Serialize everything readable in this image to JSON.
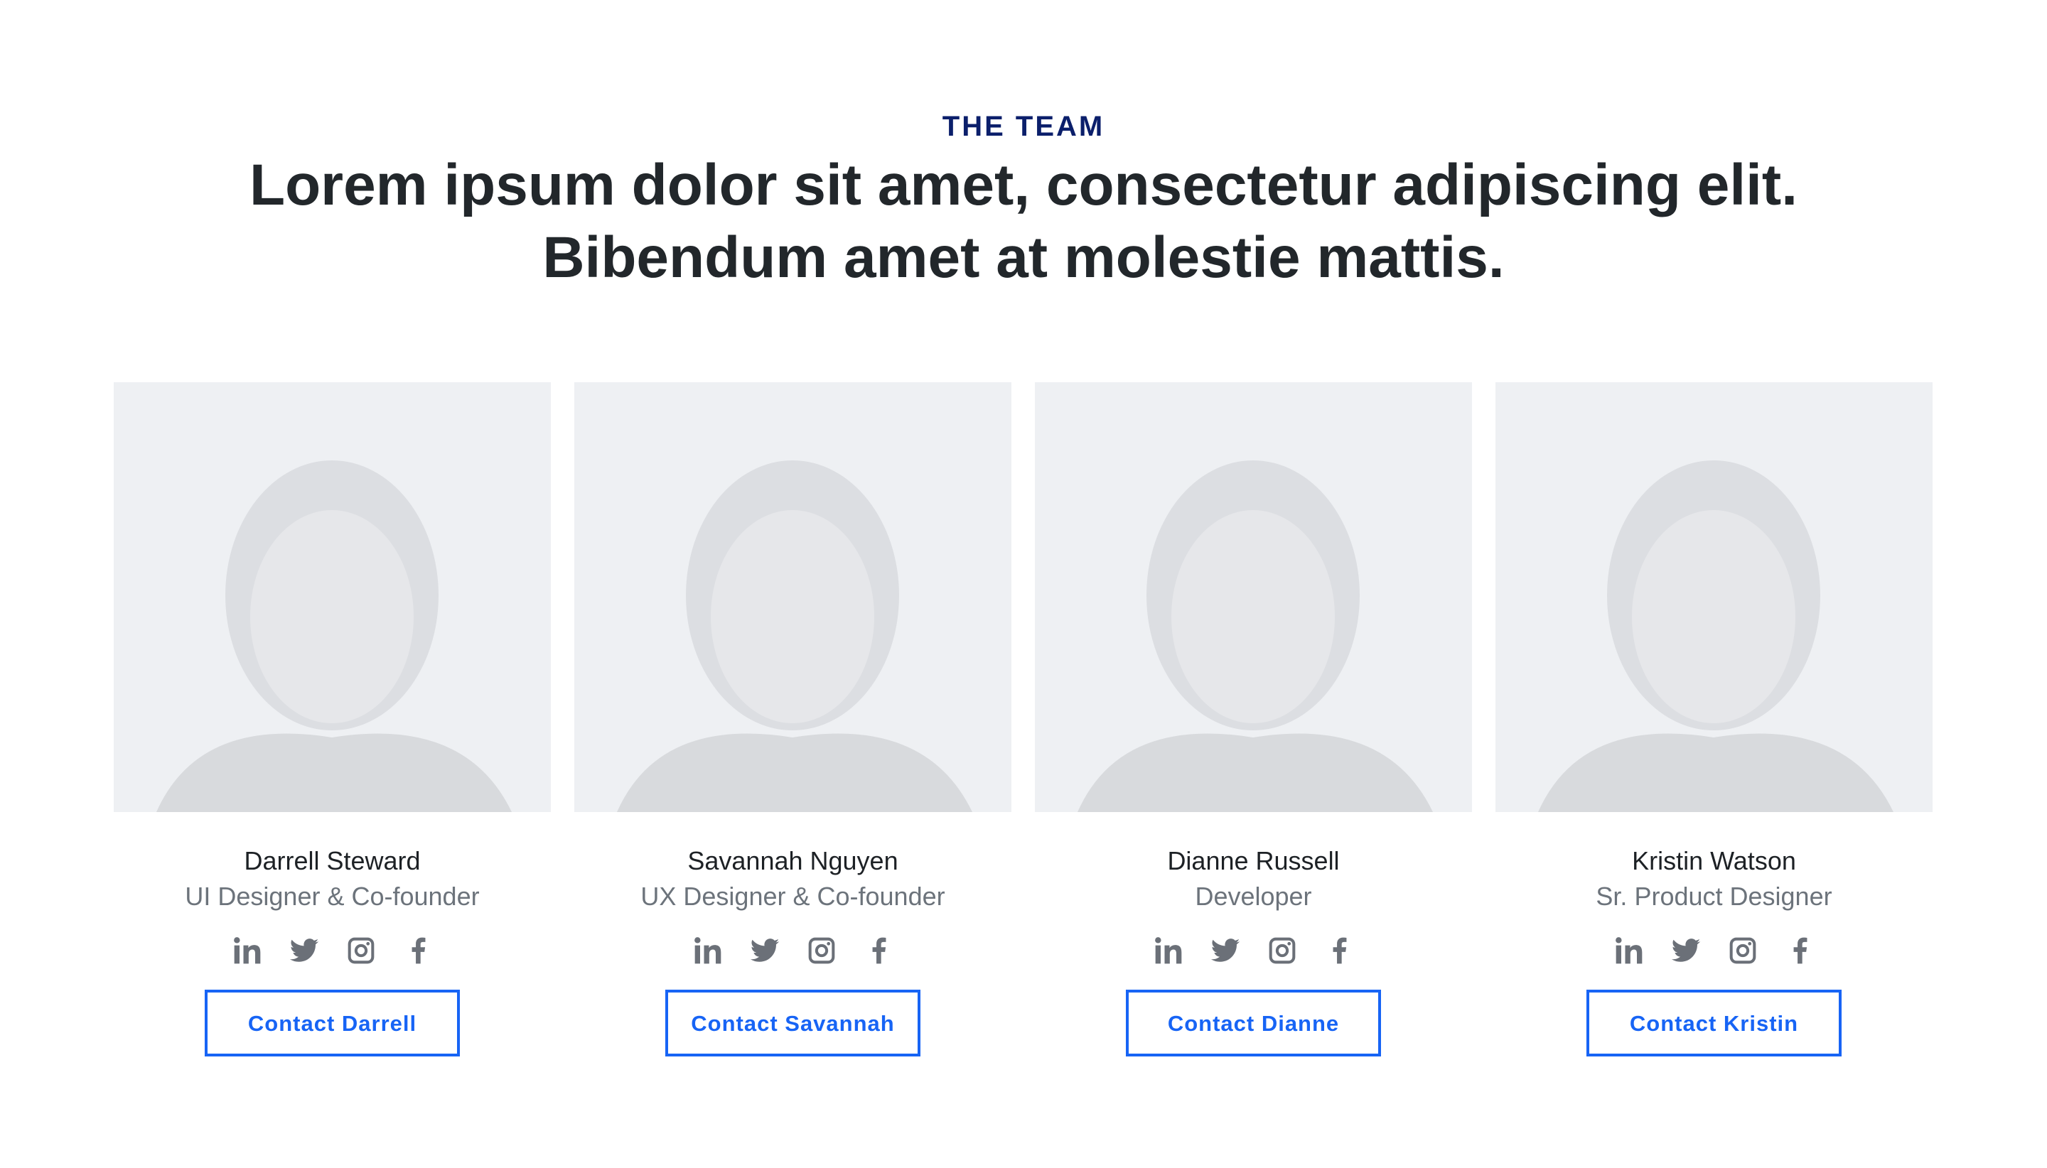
{
  "section": {
    "eyebrow": "THE TEAM",
    "headline_line1": "Lorem ipsum dolor sit amet, consectetur adipiscing elit.",
    "headline_line2": "Bibendum amet at molestie mattis."
  },
  "colors": {
    "accent": "#1764f5",
    "eyebrow": "#0b1f6b",
    "icon": "#6b7078"
  },
  "team": [
    {
      "name": "Darrell Steward",
      "role": "UI Designer & Co-founder",
      "button": "Contact Darrell"
    },
    {
      "name": "Savannah Nguyen",
      "role": "UX Designer & Co-founder",
      "button": "Contact Savannah"
    },
    {
      "name": "Dianne Russell",
      "role": "Developer",
      "button": "Contact Dianne"
    },
    {
      "name": "Kristin Watson",
      "role": "Sr. Product Designer",
      "button": "Contact Kristin"
    }
  ],
  "social_icons": [
    "linkedin-icon",
    "twitter-icon",
    "instagram-icon",
    "facebook-icon"
  ]
}
